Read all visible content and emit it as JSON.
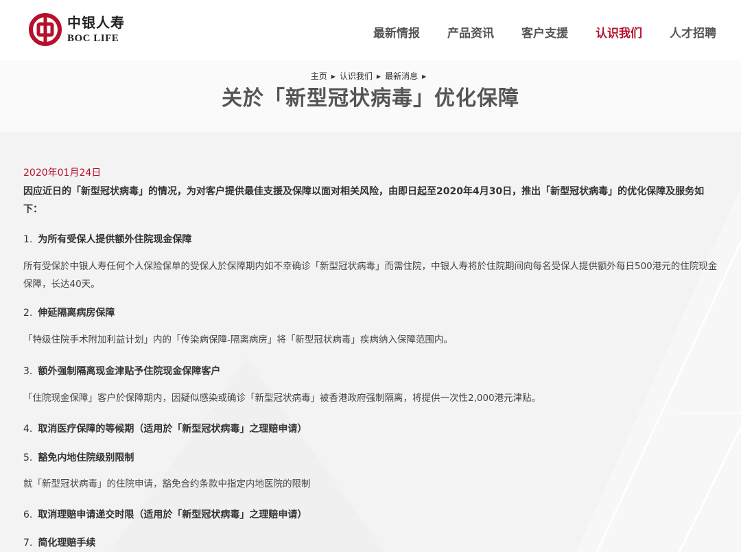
{
  "header": {
    "logo_cn": "中银人寿",
    "logo_en": "BOC LIFE",
    "nav": [
      {
        "label": "最新情报",
        "active": false
      },
      {
        "label": "产品资讯",
        "active": false
      },
      {
        "label": "客户支援",
        "active": false
      },
      {
        "label": "认识我们",
        "active": true
      },
      {
        "label": "人才招聘",
        "active": false
      }
    ]
  },
  "breadcrumb": [
    "主页",
    "认识我们",
    "最新消息"
  ],
  "page_title": "关於「新型冠状病毒」优化保障",
  "article": {
    "date": "2020年01月24日",
    "intro": "因应近日的「新型冠状病毒」的情况，为对客户提供最佳支援及保障以面对相关风险，由即日起至2020年4月30日，推出「新型冠状病毒」的优化保障及服务如下：",
    "items": [
      {
        "num": "1.",
        "title": "为所有受保人提供额外住院现金保障",
        "body": "所有受保於中银人寿任何个人保险保单的受保人於保障期内如不幸确诊「新型冠状病毒」而需住院，中银人寿将於住院期间向每名受保人提供额外每日500港元的住院现金保障，长达40天。"
      },
      {
        "num": "2.",
        "title": "伸延隔离病房保障",
        "body": "「特级住院手术附加利益计划」内的「传染病保障-隔离病房」将「新型冠状病毒」疾病纳入保障范围内。"
      },
      {
        "num": "3.",
        "title": "额外强制隔离现金津贴予住院现金保障客户",
        "body": "「住院现金保障」客户於保障期内，因疑似感染或确诊「新型冠状病毒」被香港政府强制隔离，将提供一次性2,000港元津贴。"
      },
      {
        "num": "4.",
        "title": "取消医疗保障的等候期（适用於「新型冠状病毒」之理赔申请）",
        "body": ""
      },
      {
        "num": "5.",
        "title": "豁免内地住院级别限制",
        "body": "就「新型冠状病毒」的住院申请，豁免合约条款中指定内地医院的限制"
      },
      {
        "num": "6.",
        "title": "取消理赔申请递交时限（适用於「新型冠状病毒」之理赔申请）",
        "body": ""
      },
      {
        "num": "7.",
        "title": "简化理赔手续",
        "body": ""
      }
    ]
  },
  "colors": {
    "accent": "#b5102c",
    "title": "#555555",
    "text": "#333333"
  }
}
